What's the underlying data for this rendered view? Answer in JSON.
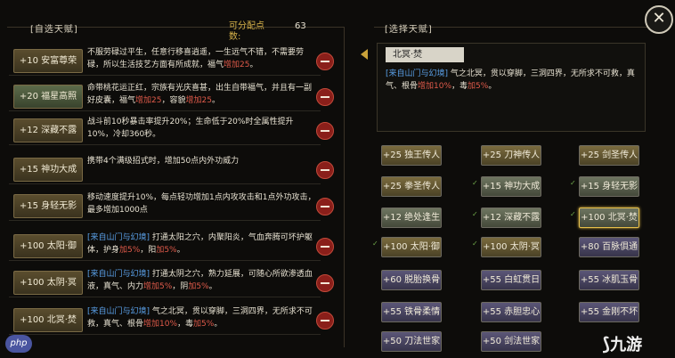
{
  "header": {
    "left_tab": "[自选天赋]",
    "points_label": "可分配点数:",
    "points_value": "63",
    "right_tab": "[选择天赋]",
    "close_label": "✕"
  },
  "talents": [
    {
      "badge": "+10 安富尊荣",
      "style": "gold",
      "desc": [
        "不服劳碌过平生，任意行移喜逍遥，一生远气不错，不需要劳碌，所以生活技艺方面有所成就，福气",
        "增加25",
        "。"
      ]
    },
    {
      "badge": "+20 福星高照",
      "style": "green",
      "desc": [
        "命带桃花运正红，宗族有光庆喜甚，出生自带福气，并且有一副好皮囊，福气",
        "增加25",
        "，容貌",
        "增加25",
        "。"
      ]
    },
    {
      "badge": "+12 深藏不露",
      "style": "gold",
      "desc": [
        "战斗前10秒暴击率提升20%；生命低于20%时全属性提升10%，冷却360秒。"
      ]
    },
    {
      "badge": "+15 神功大成",
      "style": "gold",
      "desc": [
        "携带4个满级招式时，增加50点内外功威力"
      ]
    },
    {
      "badge": "+15 身轻无影",
      "style": "gold",
      "desc": [
        "移动速度提升10%，每点轻功增加1点内攻攻击和1点外功攻击，最多增加1000点"
      ]
    },
    {
      "badge": "+100 太阳·御",
      "style": "gold",
      "blue": "[来自山门与幻境]",
      "desc": [
        " 打通太阳之穴，内聚阳炎，气血奔腾可坏护躯体，护身",
        "加5%",
        "，阳",
        "加5%",
        "。"
      ]
    },
    {
      "badge": "+100 太阴·冥",
      "style": "gold",
      "blue": "[来自山门与幻境]",
      "desc": [
        " 打通太阴之穴，熟力延展，可随心所欲渗透血液，真气、内力",
        "增加5%",
        "，阴",
        "加5%",
        "。"
      ]
    },
    {
      "badge": "+100 北冥·焚",
      "style": "gold",
      "blue": "[来自山门与幻境]",
      "desc": [
        " 气之北冥，贯以穿脚，三洞四界，无所求不可救，真气、根骨",
        "增加10%",
        "，毒",
        "加5%",
        "。"
      ]
    }
  ],
  "selected": {
    "title": "北冥·焚",
    "blue": "[来自山门与幻境]",
    "desc_pre": " 气之北冥，贯以穿脚，三洞四界，无所求不可救，真气、根骨",
    "hl1": "增加10%",
    "mid": "，毒",
    "hl2": "加5%",
    "end": "。"
  },
  "cards": [
    {
      "label": "+25 独王传人",
      "style": "y",
      "checked": false
    },
    {
      "label": "+25 刀神传人",
      "style": "y",
      "checked": false
    },
    {
      "label": "+25 剑圣传人",
      "style": "y",
      "checked": false
    },
    {
      "label": "+25 拳圣传人",
      "style": "y",
      "checked": false
    },
    {
      "label": "+15 神功大成",
      "style": "g",
      "checked": true
    },
    {
      "label": "+15 身轻无影",
      "style": "g",
      "checked": true
    },
    {
      "label": "+12 绝处逢生",
      "style": "g",
      "checked": false
    },
    {
      "label": "+12 深藏不露",
      "style": "g",
      "checked": true
    },
    {
      "label": "+100 北冥·焚",
      "style": "g",
      "checked": true,
      "selected": true
    },
    {
      "label": "+100 太阳·御",
      "style": "y",
      "checked": true
    },
    {
      "label": "+100 太阴·冥",
      "style": "y",
      "checked": true
    },
    {
      "label": "+80 百脉俱通",
      "style": "p",
      "checked": false
    },
    {
      "label": "+60 脱胎换骨",
      "style": "p",
      "checked": false
    },
    {
      "label": "+55 白虹贯日",
      "style": "p",
      "checked": false
    },
    {
      "label": "+55 冰肌玉骨",
      "style": "p",
      "checked": false
    },
    {
      "label": "+55 铁骨柔情",
      "style": "p",
      "checked": false
    },
    {
      "label": "+55 赤胆忠心",
      "style": "p",
      "checked": false
    },
    {
      "label": "+55 金刚不坏",
      "style": "p",
      "checked": false
    },
    {
      "label": "+50 刀法世家",
      "style": "p",
      "checked": false
    },
    {
      "label": "+50 剑法世家",
      "style": "p",
      "checked": false
    }
  ],
  "watermarks": {
    "left": "php",
    "right": "九游"
  }
}
